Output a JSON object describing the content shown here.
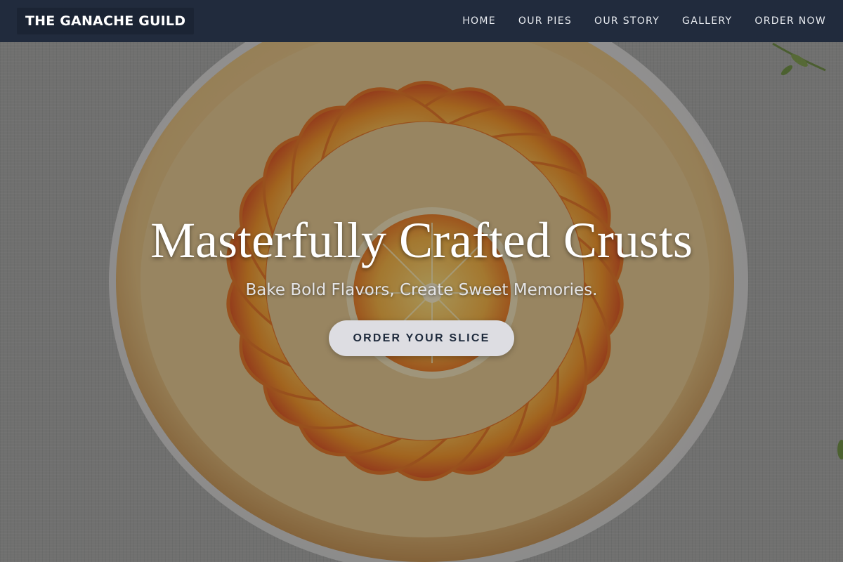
{
  "brand": {
    "name": "THE GANACHE GUILD"
  },
  "nav": {
    "items": [
      {
        "label": "HOME"
      },
      {
        "label": "OUR PIES"
      },
      {
        "label": "OUR STORY"
      },
      {
        "label": "GALLERY"
      },
      {
        "label": "ORDER NOW"
      }
    ]
  },
  "hero": {
    "title": "Masterfully Crafted Crusts",
    "subtitle": "Bake Bold Flavors, Create Sweet Memories.",
    "cta_label": "ORDER YOUR SLICE",
    "image_icon": "orange-tart-photo"
  },
  "colors": {
    "nav_background": "#212b3d",
    "cta_background": "#dddde2",
    "cta_text": "#1e2a3c"
  }
}
